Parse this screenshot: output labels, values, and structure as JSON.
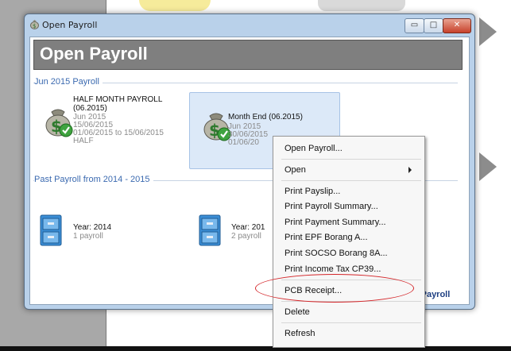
{
  "window": {
    "title": "Open Payroll",
    "header": "Open Payroll",
    "buttons": {
      "minimize": "▭",
      "maximize": "□",
      "close": "✕"
    }
  },
  "sections": {
    "current": "Jun 2015 Payroll",
    "past": "Past Payroll from 2014 - 2015"
  },
  "tiles": {
    "half_month": {
      "name_line1": "HALF MONTH PAYROLL",
      "name_line2": "(06.2015)",
      "detail1": "Jun 2015",
      "detail2": "15/06/2015",
      "detail3": "01/06/2015 to 15/06/2015",
      "detail4": "HALF"
    },
    "month_end": {
      "name": "Month End (06.2015)",
      "detail1": "Jun 2015",
      "detail2": "30/06/2015",
      "detail3": "01/06/20"
    },
    "year_2014": {
      "name": "Year: 2014",
      "detail": "1 payroll"
    },
    "year_2015": {
      "name": "Year: 201",
      "detail": "2 payroll"
    }
  },
  "new_payroll_link": "w Payroll",
  "context_menu": {
    "open_payroll": "Open Payroll...",
    "open": "Open",
    "print_payslip": "Print Payslip...",
    "print_payroll_summary": "Print Payroll Summary...",
    "print_payment_summary": "Print Payment Summary...",
    "print_epf": "Print EPF Borang A...",
    "print_socso": "Print SOCSO Borang 8A...",
    "print_income_tax": "Print Income Tax CP39...",
    "pcb_receipt": "PCB Receipt...",
    "delete": "Delete",
    "refresh": "Refresh"
  },
  "colors": {
    "accent": "#3b6ab0",
    "header_bg": "#7f7f7f",
    "selection": "#dce9f8",
    "annotation": "#d4262a"
  }
}
